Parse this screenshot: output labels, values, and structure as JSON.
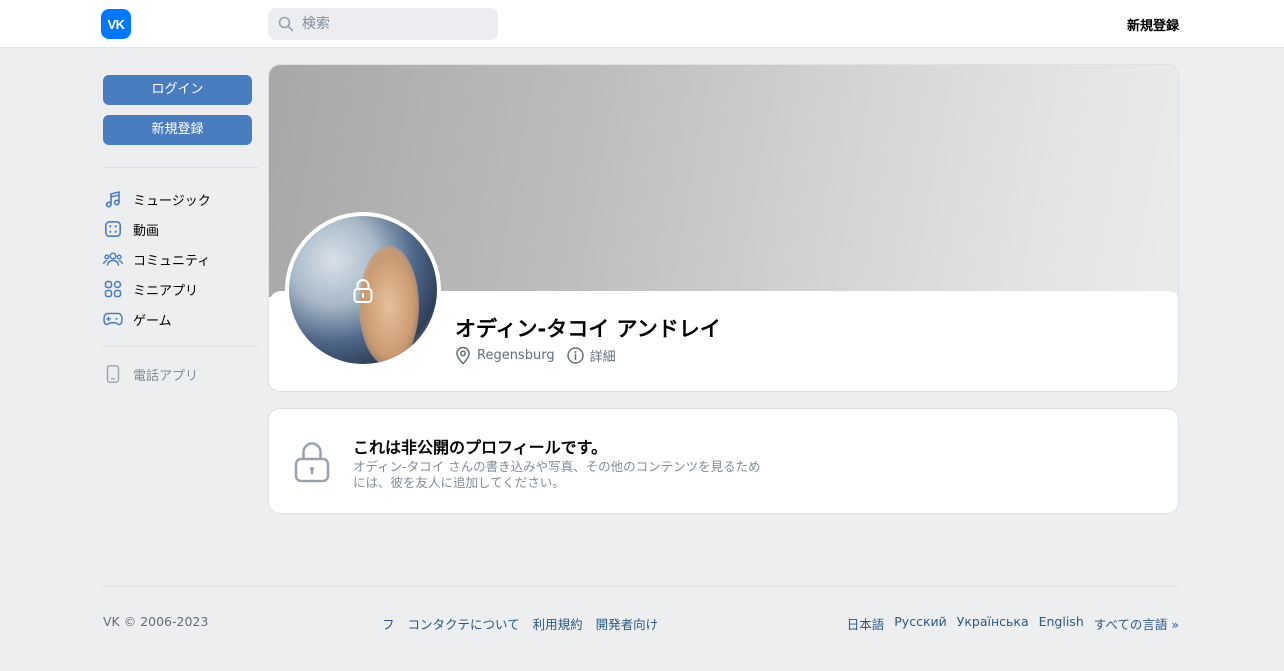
{
  "header": {
    "logo_text": "VK",
    "search_placeholder": "検索",
    "signup_label": "新規登録"
  },
  "sidebar": {
    "login_label": "ログイン",
    "signup_label": "新規登録",
    "items": [
      {
        "label": "ミュージック",
        "icon": "music-icon"
      },
      {
        "label": "動画",
        "icon": "video-icon"
      },
      {
        "label": "コミュニティ",
        "icon": "users-icon"
      },
      {
        "label": "ミニアプリ",
        "icon": "apps-icon"
      },
      {
        "label": "ゲーム",
        "icon": "gamepad-icon"
      }
    ],
    "phone_app_label": "電話アプリ"
  },
  "profile": {
    "name": "オディン-タコイ アンドレイ",
    "city": "Regensburg",
    "details_label": "詳細"
  },
  "private": {
    "title": "これは非公開のプロフィールです。",
    "description": "オディン-タコイ さんの書き込みや写真、その他のコンテンツを見るためには、彼を友人に追加してください。"
  },
  "footer": {
    "copyright": "VK © 2006-2023",
    "links": [
      "フ",
      "コンタクテについて",
      "利用規約",
      "開発者向け"
    ],
    "languages": [
      "日本語",
      "Русский",
      "Українська",
      "English",
      "すべての言語 »"
    ]
  },
  "colors": {
    "brand": "#0077ff",
    "button": "#4a7cc0",
    "link": "#2a5885",
    "background": "#edeef0"
  }
}
